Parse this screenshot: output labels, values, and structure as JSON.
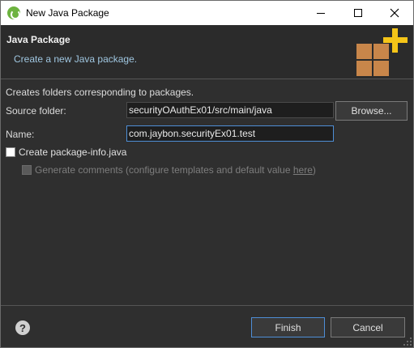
{
  "window": {
    "title": "New Java Package"
  },
  "banner": {
    "title": "Java Package",
    "description": "Create a new Java package."
  },
  "form": {
    "description": "Creates folders corresponding to packages.",
    "source_folder_label": "Source folder:",
    "source_folder_value": "securityOAuthEx01/src/main/java",
    "browse_label": "Browse...",
    "name_label": "Name:",
    "name_value": "com.jaybon.securityEx01.test",
    "create_package_info_label": "Create package-info.java",
    "create_package_info_checked": false,
    "generate_comments_label": "Generate comments (configure templates and default value ",
    "generate_comments_link": "here",
    "generate_comments_suffix": ")",
    "generate_comments_enabled": false
  },
  "footer": {
    "finish_label": "Finish",
    "cancel_label": "Cancel",
    "help_glyph": "?"
  },
  "colors": {
    "background": "#2f2f2f",
    "accent": "#4e8ed6",
    "package_icon": "#c8864a",
    "plus_icon": "#f5c518"
  }
}
